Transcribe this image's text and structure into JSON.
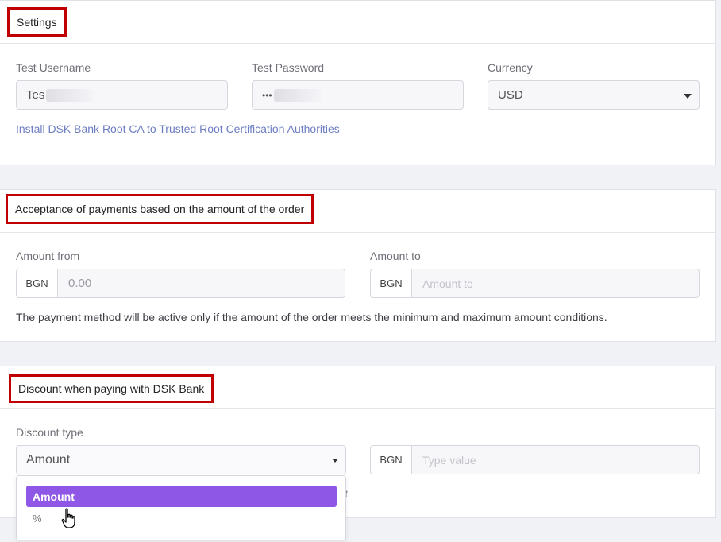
{
  "settings": {
    "title": "Settings",
    "username_label": "Test Username",
    "username_value": "Tes",
    "password_label": "Test Password",
    "password_value": "•••",
    "currency_label": "Currency",
    "currency_value": "USD",
    "install_link": "Install DSK Bank Root CA to Trusted Root Certification Authorities"
  },
  "acceptance": {
    "title": "Acceptance of payments based on the amount of the order",
    "from_label": "Amount from",
    "from_currency": "BGN",
    "from_value": "0.00",
    "to_label": "Amount to",
    "to_currency": "BGN",
    "to_placeholder": "Amount to",
    "note": "The payment method will be active only if the amount of the order meets the minimum and maximum amount conditions."
  },
  "discount": {
    "title": "Discount when paying with DSK Bank",
    "type_label": "Discount type",
    "type_value": "Amount",
    "value_currency": "BGN",
    "value_placeholder": "Type value",
    "trailing_text": "t",
    "options": [
      "Amount",
      "%"
    ]
  },
  "colors": {
    "highlight_border": "#c00000",
    "selected_option": "#8f57e6",
    "link": "#6d7dc2"
  }
}
